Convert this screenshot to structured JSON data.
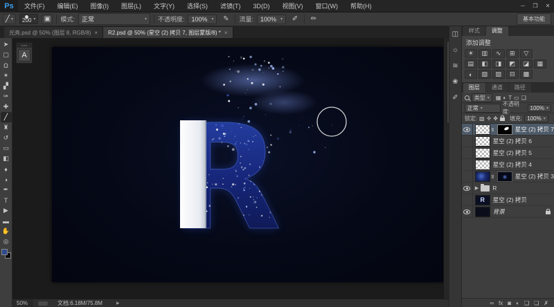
{
  "window": {
    "logo": "Ps",
    "controls": [
      {
        "name": "minimize-button",
        "glyph": "─"
      },
      {
        "name": "maximize-button",
        "glyph": "❐"
      },
      {
        "name": "close-button",
        "glyph": "✕"
      }
    ]
  },
  "menubar": {
    "items": [
      "文件(F)",
      "编辑(E)",
      "图像(I)",
      "图层(L)",
      "文字(Y)",
      "选择(S)",
      "滤镜(T)",
      "3D(D)",
      "视图(V)",
      "窗口(W)",
      "帮助(H)"
    ]
  },
  "options_bar": {
    "brush_size": "200",
    "mode_label": "模式:",
    "mode_value": "正常",
    "opacity_label": "不透明度:",
    "opacity_value": "100%",
    "flow_label": "流量:",
    "flow_value": "100%",
    "workspace_label": "基本功能"
  },
  "document_tabs": [
    {
      "title": "光亮.psd @ 50% (图层 8, RGB/8)",
      "close": "×",
      "active": false
    },
    {
      "title": "R2.psd @ 50% (星空 (2) 拷贝 7, 图层蒙版/8) *",
      "close": "×",
      "active": true
    }
  ],
  "toolbar": {
    "tools": [
      {
        "name": "move-tool-icon",
        "glyph": "➤"
      },
      {
        "name": "marquee-tool-icon",
        "glyph": "▢"
      },
      {
        "name": "lasso-tool-icon",
        "glyph": "Ω"
      },
      {
        "name": "quick-selection-tool-icon",
        "glyph": "✶"
      },
      {
        "name": "crop-tool-icon",
        "glyph": "▞"
      },
      {
        "name": "eyedropper-tool-icon",
        "glyph": "✑"
      },
      {
        "name": "healing-brush-tool-icon",
        "glyph": "✚"
      },
      {
        "name": "brush-tool-icon",
        "glyph": "╱",
        "active": true
      },
      {
        "name": "clone-stamp-tool-icon",
        "glyph": "♜"
      },
      {
        "name": "history-brush-tool-icon",
        "glyph": "↺"
      },
      {
        "name": "eraser-tool-icon",
        "glyph": "▭"
      },
      {
        "name": "gradient-tool-icon",
        "glyph": "◧"
      },
      {
        "name": "blur-tool-icon",
        "glyph": "♦"
      },
      {
        "name": "dodge-tool-icon",
        "glyph": "◑"
      },
      {
        "name": "pen-tool-icon",
        "glyph": "✒"
      },
      {
        "name": "type-tool-icon",
        "glyph": "T"
      },
      {
        "name": "path-select-tool-icon",
        "glyph": "▶"
      },
      {
        "name": "shape-tool-icon",
        "glyph": "▬"
      },
      {
        "name": "hand-tool-icon",
        "glyph": "✋"
      },
      {
        "name": "zoom-tool-icon",
        "glyph": "◎"
      }
    ],
    "foreground_color": "#2e4a8f",
    "background_color": "#0b0d12"
  },
  "floating_panel": {
    "label": "A"
  },
  "right_strip": {
    "icons": [
      {
        "name": "properties-panel-icon",
        "glyph": "◫"
      },
      {
        "name": "styles-panel-icon",
        "glyph": "☼"
      },
      {
        "name": "swatches-panel-icon",
        "glyph": "≋"
      },
      {
        "name": "brush-presets-panel-icon",
        "glyph": "❀"
      },
      {
        "name": "clone-source-panel-icon",
        "glyph": "✐"
      }
    ]
  },
  "adjustments_panel": {
    "tabs": [
      {
        "label": "样式",
        "active": false
      },
      {
        "label": "调整",
        "active": true
      }
    ],
    "header": "添加调整",
    "icon_rows": [
      [
        {
          "name": "brightness-contrast-icon",
          "glyph": "☀"
        },
        {
          "name": "levels-icon",
          "glyph": "▥"
        },
        {
          "name": "curves-icon",
          "glyph": "∿"
        },
        {
          "name": "exposure-icon",
          "glyph": "⊞"
        },
        {
          "name": "vibrance-icon",
          "glyph": "▽"
        }
      ],
      [
        {
          "name": "hue-saturation-icon",
          "glyph": "▤"
        },
        {
          "name": "color-balance-icon",
          "glyph": "◧"
        },
        {
          "name": "black-white-icon",
          "glyph": "◨"
        },
        {
          "name": "photo-filter-icon",
          "glyph": "◩"
        },
        {
          "name": "channel-mixer-icon",
          "glyph": "◪"
        },
        {
          "name": "color-lookup-icon",
          "glyph": "▦"
        }
      ],
      [
        {
          "name": "invert-icon",
          "glyph": "◐"
        },
        {
          "name": "posterize-icon",
          "glyph": "▧"
        },
        {
          "name": "threshold-icon",
          "glyph": "▨"
        },
        {
          "name": "gradient-map-icon",
          "glyph": "⊟"
        },
        {
          "name": "selective-color-icon",
          "glyph": "▩"
        }
      ]
    ]
  },
  "layers_panel": {
    "tabs": [
      {
        "label": "图层",
        "active": true
      },
      {
        "label": "通道",
        "active": false
      },
      {
        "label": "路径",
        "active": false
      }
    ],
    "filter_label": "类型",
    "filter_icons": [
      {
        "name": "pixel-layers-filter-icon",
        "glyph": "▦"
      },
      {
        "name": "adjustment-layers-filter-icon",
        "glyph": "◐"
      },
      {
        "name": "type-layers-filter-icon",
        "glyph": "T"
      },
      {
        "name": "shape-layers-filter-icon",
        "glyph": "▭"
      },
      {
        "name": "smart-object-filter-icon",
        "glyph": "❏"
      }
    ],
    "blend_mode": "正常",
    "opacity_label": "不透明度:",
    "opacity_value": "100%",
    "lock_label": "锁定:",
    "lock_icons": [
      {
        "name": "lock-transparency-icon",
        "glyph": "▨"
      },
      {
        "name": "lock-pixels-icon",
        "glyph": "✛"
      },
      {
        "name": "lock-position-icon",
        "glyph": "✥"
      }
    ],
    "fill_label": "填充:",
    "fill_value": "100%",
    "layers": [
      {
        "name": "星空 (2) 拷贝 7",
        "visible": true,
        "selected": true,
        "thumb": "checker",
        "mask": "streak",
        "linked": true
      },
      {
        "name": "星空 (2) 拷贝 6",
        "visible": false,
        "thumb": "checker"
      },
      {
        "name": "星空 (2) 拷贝 5",
        "visible": false,
        "thumb": "checker"
      },
      {
        "name": "星空 (2) 拷贝 4",
        "visible": false,
        "thumb": "checker"
      },
      {
        "name": "星空 (2) 拷贝 3",
        "visible": false,
        "thumb": "galaxy",
        "mask": "image",
        "linked": true
      },
      {
        "name": "R",
        "visible": true,
        "kind": "group"
      },
      {
        "name": "星空 (2) 拷贝",
        "visible": false,
        "thumb": "image"
      },
      {
        "name": "背景",
        "visible": true,
        "kind": "background",
        "thumb": "solid",
        "locked": true
      }
    ],
    "bottom_icons": [
      {
        "name": "link-layers-icon",
        "glyph": "∞"
      },
      {
        "name": "layer-style-icon",
        "glyph": "fx"
      },
      {
        "name": "add-layer-mask-icon",
        "glyph": "◙"
      },
      {
        "name": "new-adjustment-layer-icon",
        "glyph": "◐"
      },
      {
        "name": "new-group-icon",
        "glyph": "❑"
      },
      {
        "name": "new-layer-icon",
        "glyph": "❏"
      },
      {
        "name": "delete-layer-icon",
        "glyph": "✗"
      }
    ]
  },
  "status_bar": {
    "zoom": "50%",
    "doc_info": "文档:6.18M/75.8M",
    "arrow": "▶"
  },
  "artwork": {
    "letter": "R"
  }
}
